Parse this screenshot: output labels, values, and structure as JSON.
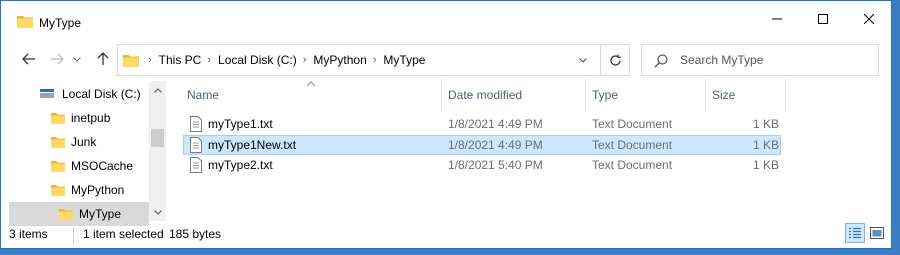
{
  "window": {
    "title": "MyType",
    "buttons": [
      "minimize-icon",
      "maximize-icon",
      "close-icon"
    ]
  },
  "nav": {
    "back": "arrow-left-icon",
    "forward": "arrow-right-icon",
    "recent": "chevron-down-icon",
    "up": "arrow-up-icon",
    "breadcrumbs": [
      "This PC",
      "Local Disk (C:)",
      "MyPython",
      "MyType"
    ],
    "refresh": "refresh-icon"
  },
  "search": {
    "placeholder": "Search MyType"
  },
  "tree": {
    "items": [
      {
        "label": "Local Disk (C:)",
        "icon": "drive-icon",
        "selected": false
      },
      {
        "label": "inetpub",
        "icon": "folder-icon",
        "selected": false
      },
      {
        "label": "Junk",
        "icon": "folder-icon",
        "selected": false
      },
      {
        "label": "MSOCache",
        "icon": "folder-icon",
        "selected": false
      },
      {
        "label": "MyPython",
        "icon": "folder-icon",
        "selected": false
      },
      {
        "label": "MyType",
        "icon": "folder-icon",
        "selected": true
      }
    ]
  },
  "columns": {
    "name": "Name",
    "date": "Date modified",
    "type": "Type",
    "size": "Size"
  },
  "files": [
    {
      "name": "myType1.txt",
      "date": "1/8/2021 4:49 PM",
      "type": "Text Document",
      "size": "1 KB",
      "selected": false
    },
    {
      "name": "myType1New.txt",
      "date": "1/8/2021 4:49 PM",
      "type": "Text Document",
      "size": "1 KB",
      "selected": true
    },
    {
      "name": "myType2.txt",
      "date": "1/8/2021 5:40 PM",
      "type": "Text Document",
      "size": "1 KB",
      "selected": false
    }
  ],
  "status": {
    "item_count": "3 items",
    "selection": "1 item selected",
    "selection_size": "185 bytes",
    "view_details": "details-view-icon",
    "view_large": "large-icons-view-icon"
  },
  "colors": {
    "accent": "#0078d7",
    "selection_bg": "#cce8ff",
    "selection_border": "#99d1ff",
    "folder": "#ffd866",
    "header_text": "#4c607a"
  }
}
